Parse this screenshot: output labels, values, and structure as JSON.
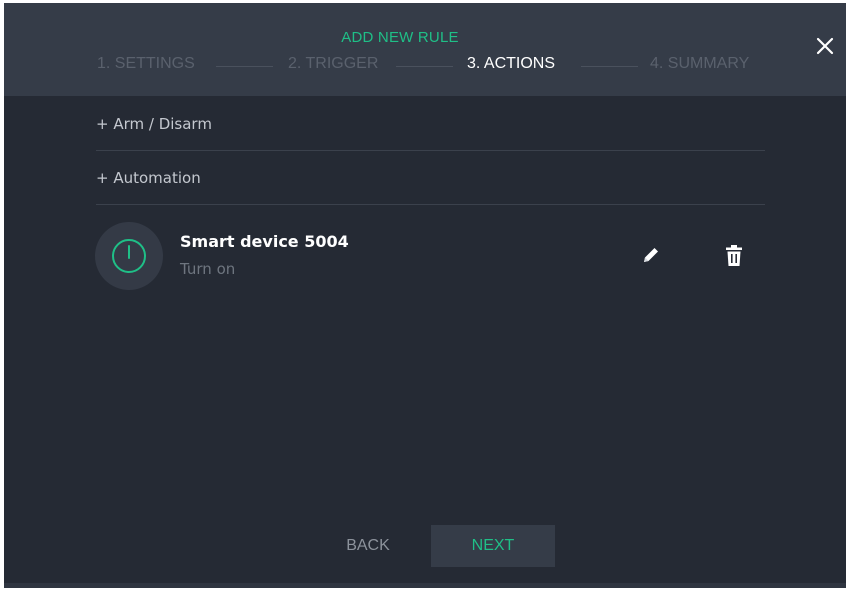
{
  "dialog": {
    "title": "ADD NEW RULE",
    "steps": [
      "1. SETTINGS",
      "2. TRIGGER",
      "3. ACTIONS",
      "4. SUMMARY"
    ],
    "active_step_index": 2
  },
  "actions": {
    "add_items": [
      "+ Arm / Disarm",
      "+ Automation"
    ],
    "configured": [
      {
        "name": "Smart device 5004",
        "action": "Turn on",
        "icon": "power-icon"
      }
    ]
  },
  "footer": {
    "back_label": "BACK",
    "next_label": "NEXT"
  },
  "colors": {
    "accent": "#1fbf87",
    "background": "#252a34",
    "header": "#353c48"
  }
}
